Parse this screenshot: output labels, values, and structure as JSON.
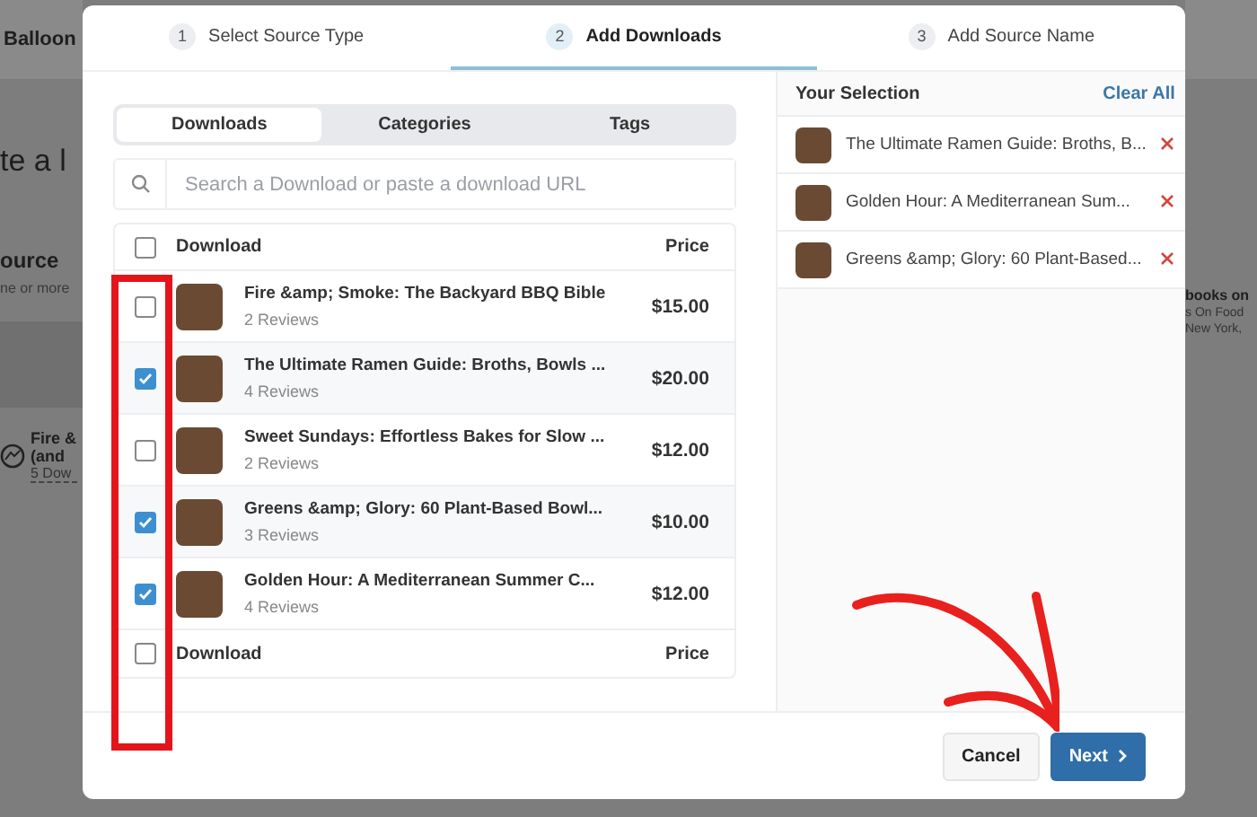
{
  "background": {
    "brand": "Balloon",
    "heading": "te a l",
    "section_title": "ource",
    "section_hint": "ne or more",
    "item_title_lines": [
      "Fire &",
      "(and"
    ],
    "item_meta": "5 Dow",
    "side_title": "books on",
    "side_lines": [
      "s On Food",
      "New York, "
    ]
  },
  "steps": [
    {
      "number": "1",
      "label": "Select Source Type",
      "selected": false
    },
    {
      "number": "2",
      "label": "Add Downloads",
      "selected": true
    },
    {
      "number": "3",
      "label": "Add Source Name",
      "selected": false
    }
  ],
  "tabs": [
    {
      "label": "Downloads",
      "selected": true
    },
    {
      "label": "Categories",
      "selected": false
    },
    {
      "label": "Tags",
      "selected": false
    }
  ],
  "search": {
    "placeholder": "Search a Download or paste a download URL"
  },
  "table": {
    "columns": [
      "Download",
      "Price"
    ],
    "header_checked": false,
    "footer_checked": false,
    "footer_columns": [
      "Download",
      "Price"
    ],
    "rows": [
      {
        "title": "Fire &amp; Smoke: The Backyard BBQ Bible",
        "reviews": "2 Reviews",
        "price": "$15.00",
        "checked": false
      },
      {
        "title": "The Ultimate Ramen Guide: Broths, Bowls ...",
        "reviews": "4 Reviews",
        "price": "$20.00",
        "checked": true
      },
      {
        "title": "Sweet Sundays: Effortless Bakes for Slow ...",
        "reviews": "2 Reviews",
        "price": "$12.00",
        "checked": false
      },
      {
        "title": "Greens &amp; Glory: 60 Plant-Based Bowl...",
        "reviews": "3 Reviews",
        "price": "$10.00",
        "checked": true
      },
      {
        "title": "Golden Hour: A Mediterranean Summer C...",
        "reviews": "4 Reviews",
        "price": "$12.00",
        "checked": true
      }
    ]
  },
  "selection": {
    "title": "Your Selection",
    "clear": "Clear All",
    "items": [
      {
        "title": "The Ultimate Ramen Guide: Broths, B..."
      },
      {
        "title": "Golden Hour: A Mediterranean Sum..."
      },
      {
        "title": "Greens &amp; Glory: 60 Plant-Based..."
      }
    ]
  },
  "buttons": {
    "cancel": "Cancel",
    "next": "Next"
  }
}
